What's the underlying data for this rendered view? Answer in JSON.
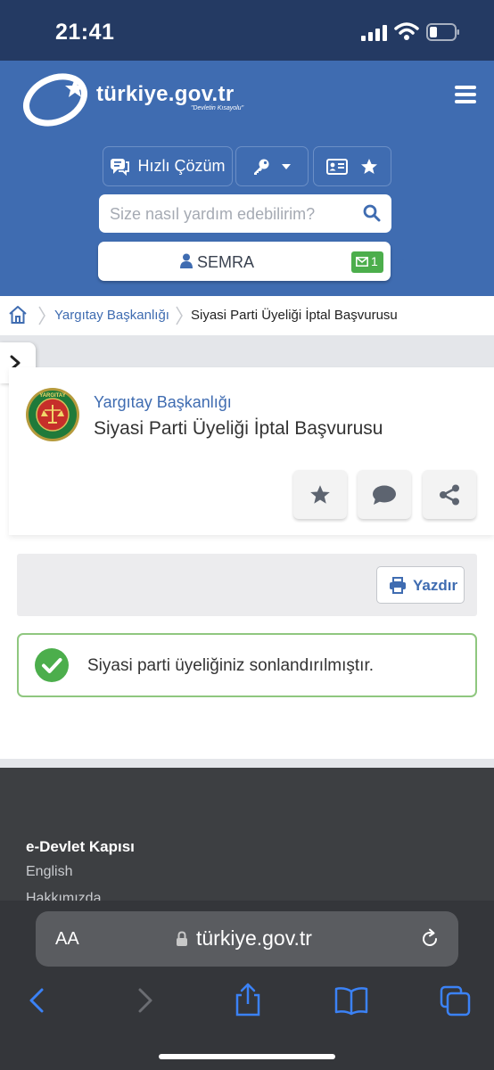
{
  "status_bar": {
    "time": "21:41"
  },
  "header": {
    "logo_text": "türkiye.gov.tr",
    "logo_tagline": "\"Devletin Kısayolu\"",
    "quick_solution_label": "Hızlı Çözüm",
    "search_placeholder": "Size nasıl yardım edebilirim?",
    "user_name": "SEMRA",
    "message_count": "1",
    "icons": [
      "hamburger-menu-icon",
      "chat-icon",
      "key-icon",
      "chevron-down-icon",
      "id-card-icon",
      "star-icon",
      "search-icon",
      "user-icon",
      "mail-icon"
    ]
  },
  "breadcrumb": {
    "items": [
      "Yargıtay Başkanlığı",
      "Siyasi Parti Üyeliği İptal Başvurusu"
    ]
  },
  "service": {
    "organization": "Yargıtay Başkanlığı",
    "title": "Siyasi Parti Üyeliği İptal Başvurusu",
    "emblem_text": "YARGITAY"
  },
  "print": {
    "label": "Yazdır"
  },
  "alert": {
    "message": "Siyasi parti üyeliğiniz sonlandırılmıştır."
  },
  "footer": {
    "title": "e-Devlet Kapısı",
    "links": [
      "English",
      "Hakkımızda"
    ]
  },
  "browser": {
    "aa_label": "AA",
    "domain": "türkiye.gov.tr"
  },
  "colors": {
    "header_blue": "#3f6cb1",
    "status_bar": "#243a63",
    "success_green": "#4cae4c",
    "footer": "#3d3f42"
  }
}
